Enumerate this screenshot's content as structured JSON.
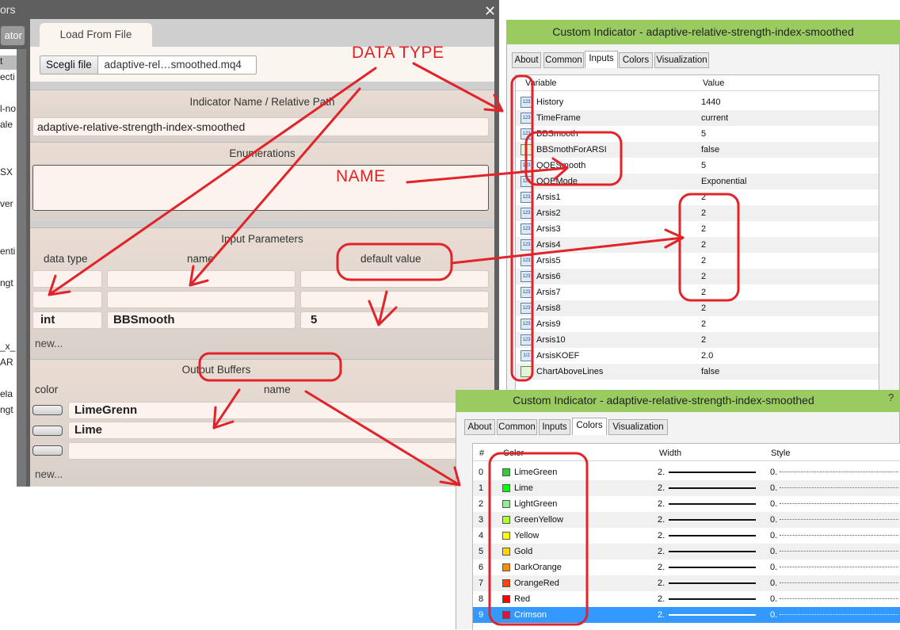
{
  "left_window": {
    "title_fragment": "ors",
    "close_glyph": "✕",
    "side_button_label": "ator",
    "list_items": [
      "t",
      "ecti",
      "",
      "l-no",
      "ale",
      "",
      "",
      "SX",
      "",
      "ver",
      "",
      "",
      "enti",
      "",
      "ngt",
      "",
      "",
      "",
      "_x_",
      "AR",
      "",
      "ela",
      "ngt"
    ]
  },
  "editor": {
    "tab_label": "Load From File",
    "file_button": "Scegli file",
    "file_name": "adaptive-rel…smoothed.mq4",
    "indicator_section_title": "Indicator Name / Relative Path",
    "indicator_name": "adaptive-relative-strength-index-smoothed",
    "enumerations_title": "Enumerations",
    "inputs_title": "Input Parameters",
    "inputs_columns": [
      "data type",
      "name",
      "default value"
    ],
    "inputs_rows": [
      {
        "type": "",
        "name": "",
        "default": ""
      },
      {
        "type": "",
        "name": "",
        "default": ""
      },
      {
        "type": "int",
        "name": "BBSmooth",
        "default": "5"
      }
    ],
    "new_label": "new...",
    "buffers_title": "Output Buffers",
    "buffers_columns": [
      "color",
      "name"
    ],
    "buffers_rows": [
      {
        "name": "LimeGrenn"
      },
      {
        "name": "Lime"
      },
      {
        "name": ""
      }
    ]
  },
  "inputs_window": {
    "title": "Custom Indicator - adaptive-relative-strength-index-smoothed",
    "tabs": [
      "About",
      "Common",
      "Inputs",
      "Colors",
      "Visualization"
    ],
    "active_tab": "Inputs",
    "columns": [
      "Variable",
      "Value"
    ],
    "rows": [
      {
        "icon": "123",
        "variable": "History",
        "value": "1440"
      },
      {
        "icon": "123",
        "variable": "TimeFrame",
        "value": "current"
      },
      {
        "icon": "123",
        "variable": "BBSmooth",
        "value": "5"
      },
      {
        "icon": "bool",
        "variable": "BBSmothForARSI",
        "value": "false"
      },
      {
        "icon": "123",
        "variable": "QQESmooth",
        "value": "5"
      },
      {
        "icon": "123",
        "variable": "QQEMode",
        "value": "Exponential"
      },
      {
        "icon": "123",
        "variable": "Arsis1",
        "value": "2"
      },
      {
        "icon": "123",
        "variable": "Arsis2",
        "value": "2"
      },
      {
        "icon": "123",
        "variable": "Arsis3",
        "value": "2"
      },
      {
        "icon": "123",
        "variable": "Arsis4",
        "value": "2"
      },
      {
        "icon": "123",
        "variable": "Arsis5",
        "value": "2"
      },
      {
        "icon": "123",
        "variable": "Arsis6",
        "value": "2"
      },
      {
        "icon": "123",
        "variable": "Arsis7",
        "value": "2"
      },
      {
        "icon": "123",
        "variable": "Arsis8",
        "value": "2"
      },
      {
        "icon": "123",
        "variable": "Arsis9",
        "value": "2"
      },
      {
        "icon": "123",
        "variable": "Arsis10",
        "value": "2"
      },
      {
        "icon": "1/2",
        "variable": "ArsisKOEF",
        "value": "2.0"
      },
      {
        "icon": "bool",
        "variable": "ChartAboveLines",
        "value": "false"
      }
    ]
  },
  "colors_window": {
    "title": "Custom Indicator - adaptive-relative-strength-index-smoothed",
    "help_glyph": "?",
    "tabs": [
      "About",
      "Common",
      "Inputs",
      "Colors",
      "Visualization"
    ],
    "active_tab": "Colors",
    "columns": [
      "#",
      "Color",
      "Width",
      "Style"
    ],
    "rows": [
      {
        "index": "0",
        "name": "LimeGreen",
        "hex": "#32cd32",
        "width": "2.",
        "style": "0."
      },
      {
        "index": "1",
        "name": "Lime",
        "hex": "#00ff00",
        "width": "2.",
        "style": "0."
      },
      {
        "index": "2",
        "name": "LightGreen",
        "hex": "#90ee90",
        "width": "2.",
        "style": "0."
      },
      {
        "index": "3",
        "name": "GreenYellow",
        "hex": "#adff2f",
        "width": "2.",
        "style": "0."
      },
      {
        "index": "4",
        "name": "Yellow",
        "hex": "#ffff00",
        "width": "2.",
        "style": "0."
      },
      {
        "index": "5",
        "name": "Gold",
        "hex": "#ffd700",
        "width": "2.",
        "style": "0."
      },
      {
        "index": "6",
        "name": "DarkOrange",
        "hex": "#ff8c00",
        "width": "2.",
        "style": "0."
      },
      {
        "index": "7",
        "name": "OrangeRed",
        "hex": "#ff4500",
        "width": "2.",
        "style": "0."
      },
      {
        "index": "8",
        "name": "Red",
        "hex": "#ff0000",
        "width": "2.",
        "style": "0."
      },
      {
        "index": "9",
        "name": "Crimson",
        "hex": "#dc143c",
        "width": "2.",
        "style": "0."
      }
    ],
    "selected_index": "9"
  },
  "annotations": {
    "data_type": "DATA TYPE",
    "name": "NAME",
    "color": "#e2232a"
  }
}
